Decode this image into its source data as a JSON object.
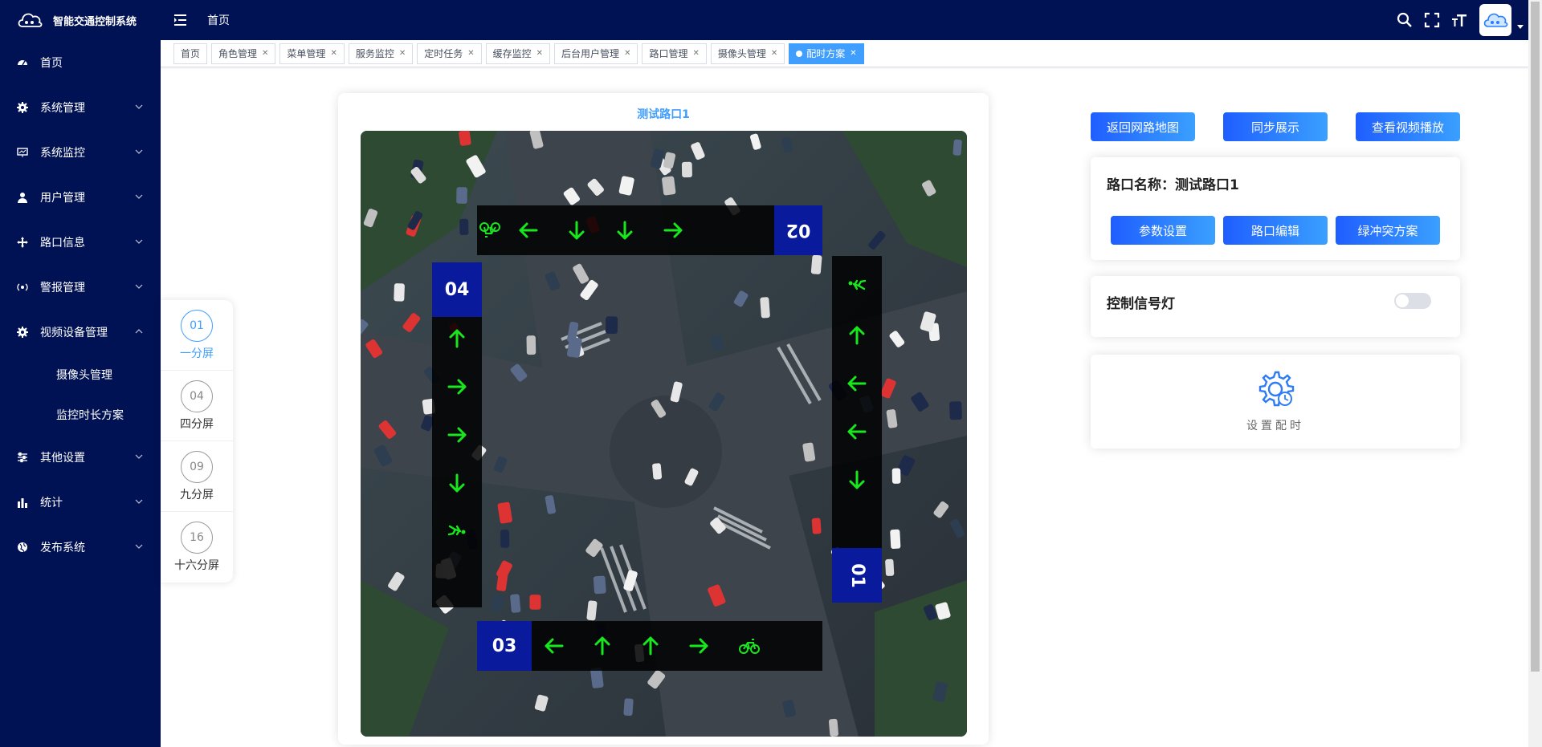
{
  "app": {
    "title": "智能交通控制系统"
  },
  "sidebar": {
    "items": [
      {
        "label": "首页",
        "icon": "dashboard-icon"
      },
      {
        "label": "系统管理",
        "icon": "gear-icon"
      },
      {
        "label": "系统监控",
        "icon": "monitor-icon"
      },
      {
        "label": "用户管理",
        "icon": "user-icon"
      },
      {
        "label": "路口信息",
        "icon": "crosshair-icon"
      },
      {
        "label": "警报管理",
        "icon": "signal-icon"
      },
      {
        "label": "视频设备管理",
        "icon": "gear-icon",
        "expanded": true,
        "children": [
          {
            "label": "摄像头管理"
          },
          {
            "label": "监控时长方案"
          }
        ]
      },
      {
        "label": "其他设置",
        "icon": "sliders-icon"
      },
      {
        "label": "统计",
        "icon": "bar-chart-icon"
      },
      {
        "label": "发布系统",
        "icon": "globe-icon"
      }
    ]
  },
  "header": {
    "breadcrumb": "首页"
  },
  "tags": [
    {
      "label": "首页",
      "closable": false
    },
    {
      "label": "角色管理",
      "closable": true
    },
    {
      "label": "菜单管理",
      "closable": true
    },
    {
      "label": "服务监控",
      "closable": true
    },
    {
      "label": "定时任务",
      "closable": true
    },
    {
      "label": "缓存监控",
      "closable": true
    },
    {
      "label": "后台用户管理",
      "closable": true
    },
    {
      "label": "路口管理",
      "closable": true
    },
    {
      "label": "摄像头管理",
      "closable": true
    },
    {
      "label": "配时方案",
      "closable": true,
      "active": true
    }
  ],
  "screens": [
    {
      "num": "01",
      "label": "一分屏",
      "active": true
    },
    {
      "num": "04",
      "label": "四分屏"
    },
    {
      "num": "09",
      "label": "九分屏"
    },
    {
      "num": "16",
      "label": "十六分屏"
    }
  ],
  "intersection": {
    "title": "测试路口1",
    "directions": {
      "top": "02",
      "bottom": "03",
      "left": "04",
      "right": "01"
    }
  },
  "actions": {
    "back_map": "返回网路地图",
    "sync_show": "同步展示",
    "view_video": "查看视频播放"
  },
  "info": {
    "road_name_label": "路口名称：",
    "road_name": "测试路口1",
    "params": "参数设置",
    "edit": "路口编辑",
    "conflict": "绿冲突方案"
  },
  "signal": {
    "label": "控制信号灯",
    "on": false
  },
  "timing": {
    "label": "设置配时"
  },
  "colors": {
    "navy": "#001253",
    "accent": "#409eff",
    "arrow": "#16e81d",
    "badge": "#0a1a9c"
  }
}
